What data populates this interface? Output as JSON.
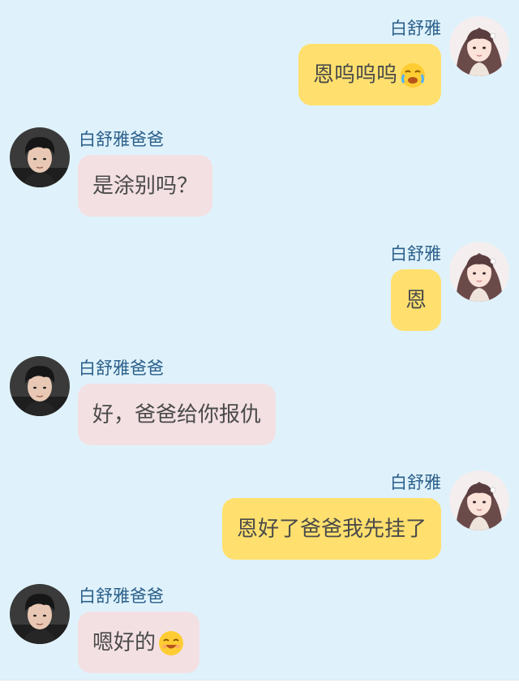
{
  "messages": [
    {
      "side": "right",
      "sender": "白舒雅",
      "text": "恩呜呜呜",
      "emoji": "crying-emoji"
    },
    {
      "side": "left",
      "sender": "白舒雅爸爸",
      "text": "是涂别吗？",
      "emoji": ""
    },
    {
      "side": "right",
      "sender": "白舒雅",
      "text": "恩",
      "emoji": ""
    },
    {
      "side": "left",
      "sender": "白舒雅爸爸",
      "text": "好，爸爸给你报仇",
      "emoji": ""
    },
    {
      "side": "right",
      "sender": "白舒雅",
      "text": "恩好了爸爸我先挂了",
      "emoji": ""
    },
    {
      "side": "left",
      "sender": "白舒雅爸爸",
      "text": "嗯好的",
      "emoji": "happy-emoji"
    }
  ],
  "colors": {
    "background": "#dff2fb",
    "sent_bubble": "#ffe06e",
    "received_bubble": "#f3e0e3",
    "name_text": "#2b5f8a",
    "bubble_text": "#4a4a4a"
  }
}
